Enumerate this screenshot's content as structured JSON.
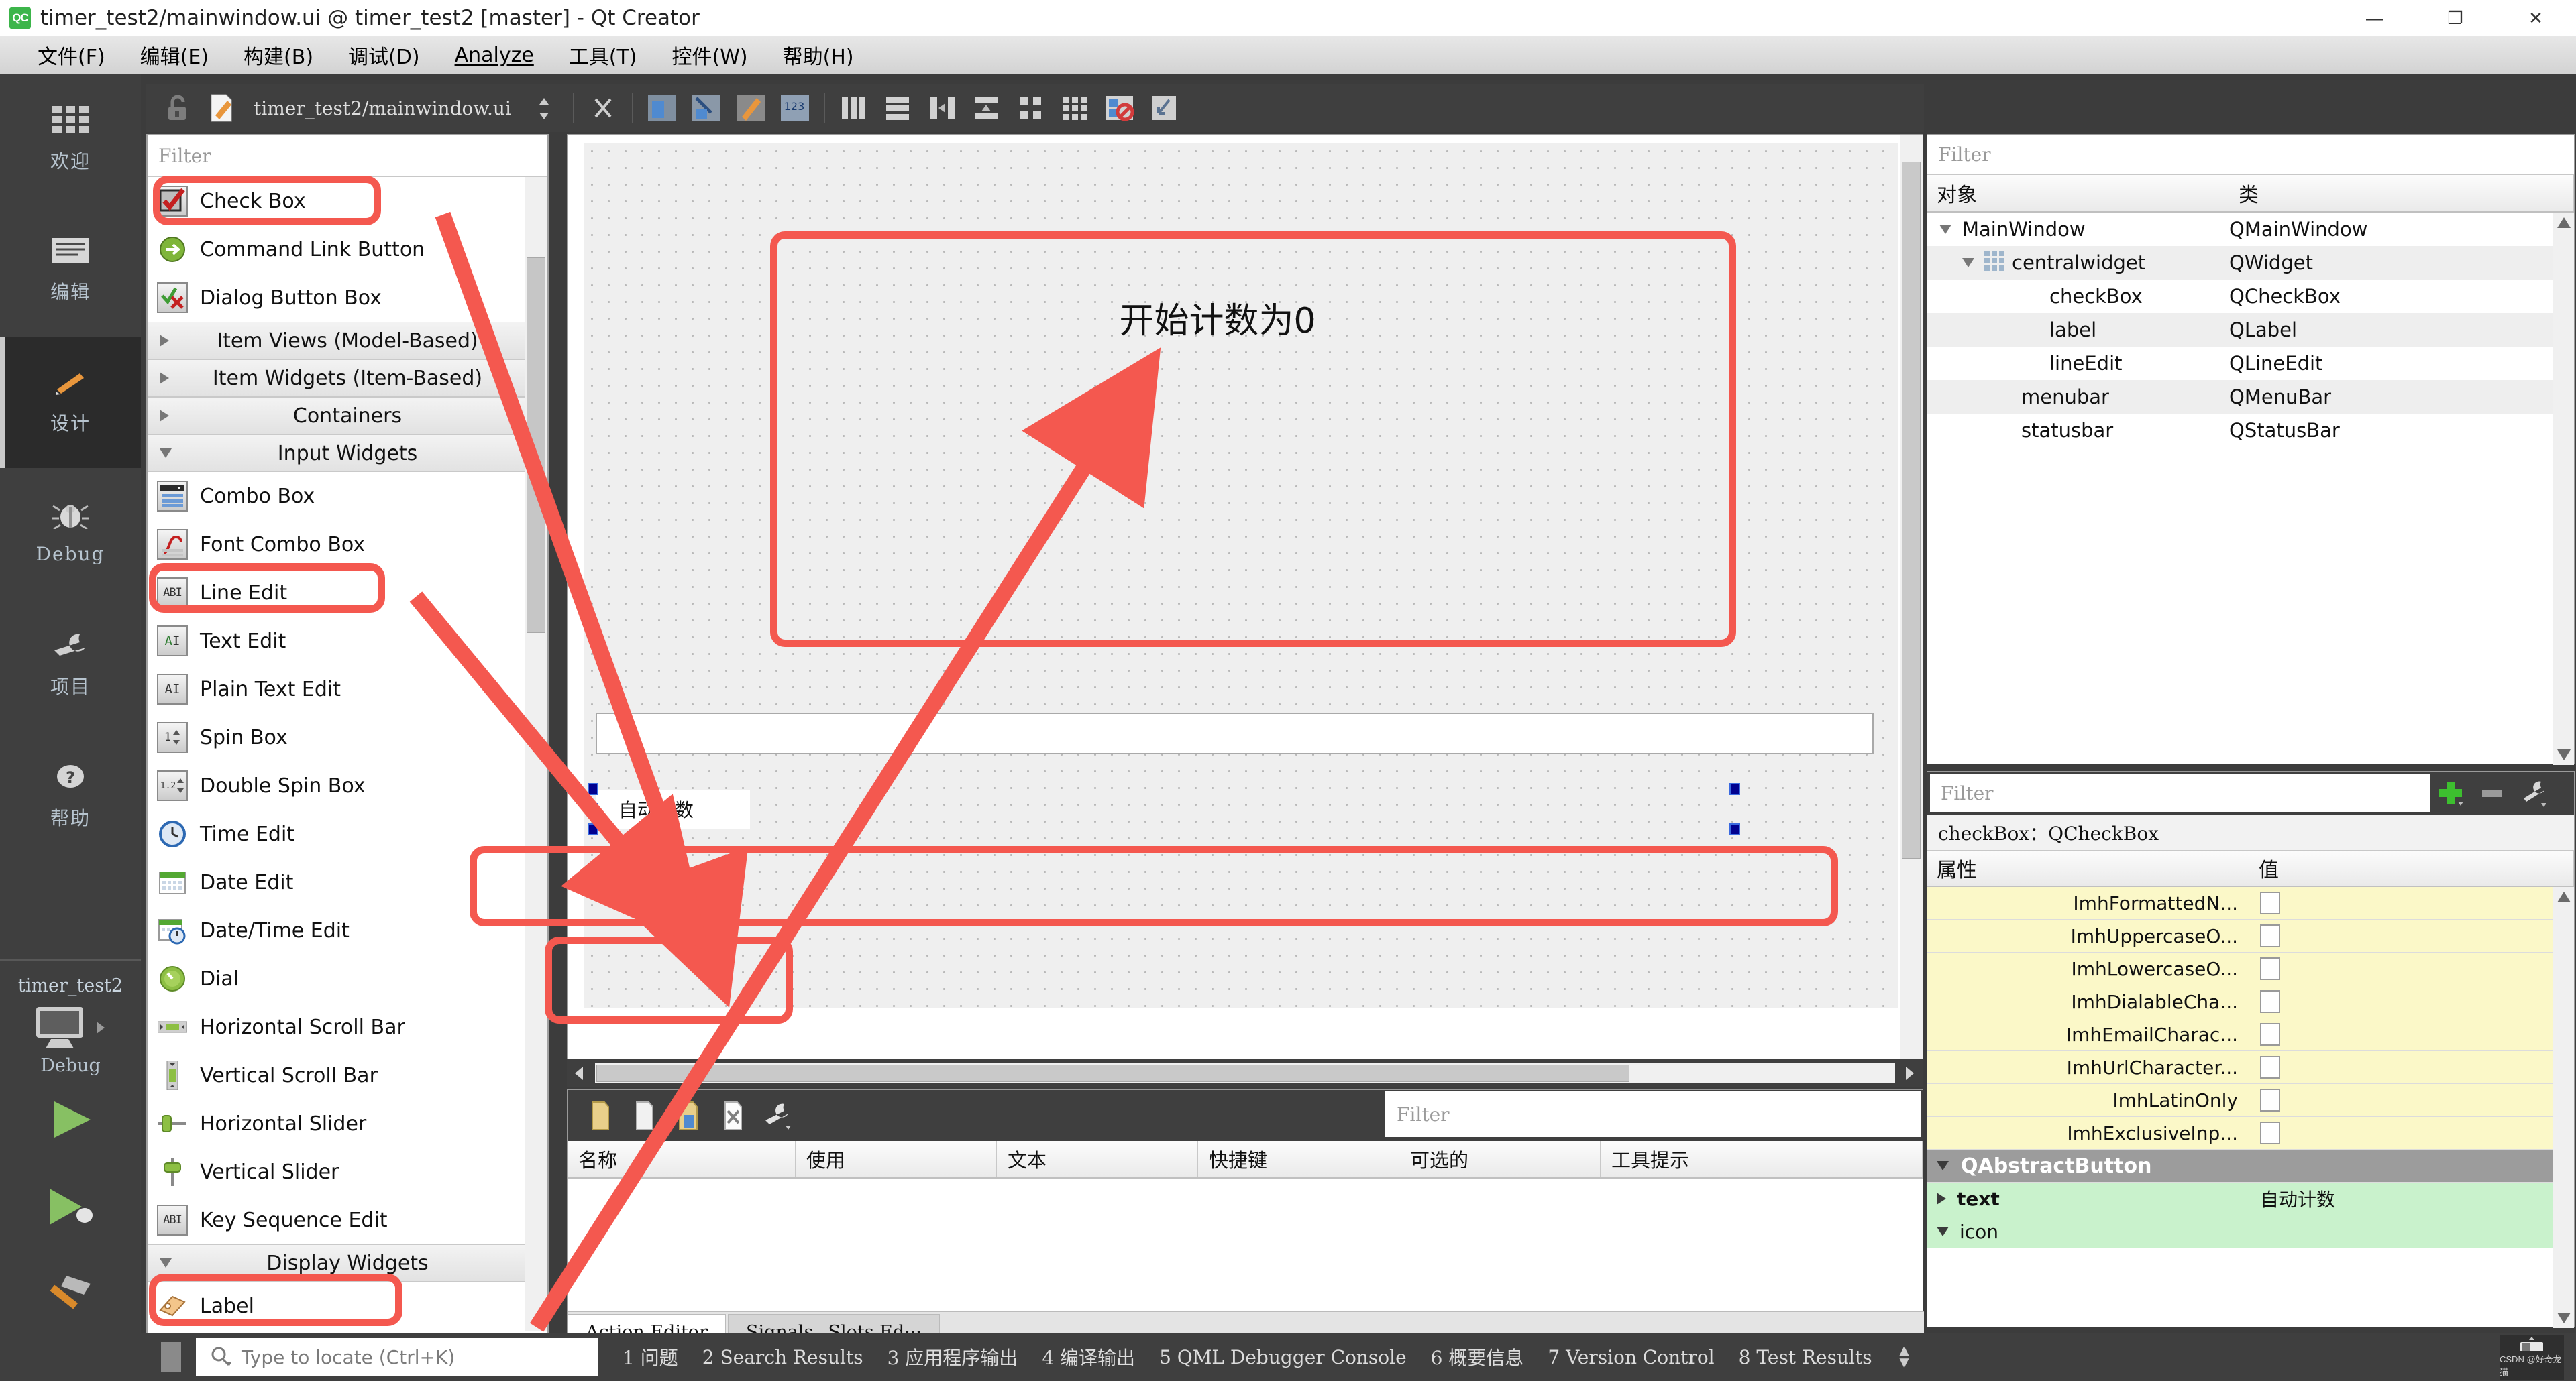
{
  "titlebar": {
    "logo": "QC",
    "title": "timer_test2/mainwindow.ui @ timer_test2 [master] - Qt Creator",
    "minimize": "—",
    "maximize": "❐",
    "close": "✕"
  },
  "menubar": {
    "items": [
      {
        "label": "文件(F)"
      },
      {
        "label": "编辑(E)"
      },
      {
        "label": "构建(B)"
      },
      {
        "label": "调试(D)"
      },
      {
        "label": "Analyze"
      },
      {
        "label": "工具(T)"
      },
      {
        "label": "控件(W)"
      },
      {
        "label": "帮助(H)"
      }
    ]
  },
  "modebar": {
    "items": [
      {
        "label": "欢迎",
        "icon": "grid-icon",
        "active": false
      },
      {
        "label": "编辑",
        "icon": "lines-icon",
        "active": false
      },
      {
        "label": "设计",
        "icon": "pencil-icon",
        "active": true
      },
      {
        "label": "Debug",
        "icon": "bug-icon",
        "active": false
      },
      {
        "label": "项目",
        "icon": "wrench-icon",
        "active": false
      },
      {
        "label": "帮助",
        "icon": "help-icon",
        "active": false
      }
    ]
  },
  "kit_selector": {
    "project": "timer_test2",
    "build": "Debug",
    "run_label": "run",
    "debug_label": "debug",
    "build_label": "build"
  },
  "widgetbox": {
    "filter_placeholder": "Filter",
    "items": [
      {
        "type": "widget",
        "label": "Check Box",
        "icon": "checkbox-icon",
        "highlighted": true
      },
      {
        "type": "widget",
        "label": "Command Link Button",
        "icon": "command-link-icon",
        "highlighted": false
      },
      {
        "type": "widget",
        "label": "Dialog Button Box",
        "icon": "dialog-buttonbox-icon",
        "highlighted": false
      },
      {
        "type": "category",
        "label": "Item Views (Model-Based)",
        "expanded": false
      },
      {
        "type": "category",
        "label": "Item Widgets (Item-Based)",
        "expanded": false
      },
      {
        "type": "category",
        "label": "Containers",
        "expanded": false
      },
      {
        "type": "category",
        "label": "Input Widgets",
        "expanded": true
      },
      {
        "type": "widget",
        "label": "Combo Box",
        "icon": "combobox-icon",
        "highlighted": false
      },
      {
        "type": "widget",
        "label": "Font Combo Box",
        "icon": "fontcombo-icon",
        "highlighted": false
      },
      {
        "type": "widget",
        "label": "Line Edit",
        "icon": "lineedit-icon",
        "highlighted": true
      },
      {
        "type": "widget",
        "label": "Text Edit",
        "icon": "textedit-icon",
        "highlighted": false
      },
      {
        "type": "widget",
        "label": "Plain Text Edit",
        "icon": "plaintextedit-icon",
        "highlighted": false
      },
      {
        "type": "widget",
        "label": "Spin Box",
        "icon": "spinbox-icon",
        "highlighted": false
      },
      {
        "type": "widget",
        "label": "Double Spin Box",
        "icon": "doublespinbox-icon",
        "highlighted": false
      },
      {
        "type": "widget",
        "label": "Time Edit",
        "icon": "clock-icon",
        "highlighted": false
      },
      {
        "type": "widget",
        "label": "Date Edit",
        "icon": "calendar-icon",
        "highlighted": false
      },
      {
        "type": "widget",
        "label": "Date/Time Edit",
        "icon": "calendar-clock-icon",
        "highlighted": false
      },
      {
        "type": "widget",
        "label": "Dial",
        "icon": "dial-icon",
        "highlighted": false
      },
      {
        "type": "widget",
        "label": "Horizontal Scroll Bar",
        "icon": "hscrollbar-icon",
        "highlighted": false
      },
      {
        "type": "widget",
        "label": "Vertical Scroll Bar",
        "icon": "vscrollbar-icon",
        "highlighted": false
      },
      {
        "type": "widget",
        "label": "Horizontal Slider",
        "icon": "hslider-icon",
        "highlighted": false
      },
      {
        "type": "widget",
        "label": "Vertical Slider",
        "icon": "vslider-icon",
        "highlighted": false
      },
      {
        "type": "widget",
        "label": "Key Sequence Edit",
        "icon": "keysequence-icon",
        "highlighted": false
      },
      {
        "type": "category",
        "label": "Display Widgets",
        "expanded": true
      },
      {
        "type": "widget",
        "label": "Label",
        "icon": "label-icon",
        "highlighted": true
      }
    ]
  },
  "form_toolbar": {
    "filename": "timer_test2/mainwindow.ui",
    "icons": [
      "unlock-icon",
      "edit-file-icon",
      "split-icon",
      "close-icon",
      "edit-widgets-icon",
      "edit-signals-icon",
      "edit-buddies-icon",
      "edit-taborder-icon",
      "layout-horizontal-icon",
      "layout-vertical-icon",
      "layout-splitter-h-icon",
      "layout-splitter-v-icon",
      "layout-form-icon",
      "layout-grid-icon",
      "break-layout-icon",
      "adjust-size-icon"
    ]
  },
  "canvas": {
    "label_text": "开始计数为0",
    "lineedit_text": "",
    "checkbox_text": "自动计数"
  },
  "action_editor": {
    "filter_placeholder": "Filter",
    "columns": [
      "名称",
      "使用",
      "文本",
      "快捷键",
      "可选的",
      "工具提示"
    ],
    "rows": [],
    "tabs": [
      {
        "label": "Action Editor",
        "selected": true
      },
      {
        "label": "Signals _Slots Ed···",
        "selected": false
      }
    ]
  },
  "object_inspector": {
    "filter_placeholder": "Filter",
    "columns": [
      "对象",
      "类"
    ],
    "rows": [
      {
        "object": "MainWindow",
        "class": "QMainWindow",
        "indent": 0,
        "expander": "down"
      },
      {
        "object": "centralwidget",
        "class": "QWidget",
        "indent": 1,
        "expander": "down",
        "icon": "widget-grid-icon"
      },
      {
        "object": "checkBox",
        "class": "QCheckBox",
        "indent": 2,
        "expander": ""
      },
      {
        "object": "label",
        "class": "QLabel",
        "indent": 2,
        "expander": ""
      },
      {
        "object": "lineEdit",
        "class": "QLineEdit",
        "indent": 2,
        "expander": ""
      },
      {
        "object": "menubar",
        "class": "QMenuBar",
        "indent": 1,
        "expander": ""
      },
      {
        "object": "statusbar",
        "class": "QStatusBar",
        "indent": 1,
        "expander": ""
      }
    ]
  },
  "property_editor": {
    "filter_placeholder": "Filter",
    "add_label": "+",
    "remove_label": "−",
    "configure_label": "⚙",
    "subject": "checkBox：QCheckBox",
    "columns": [
      "属性",
      "值"
    ],
    "rows": [
      {
        "name": "ImhFormattedN...",
        "value": "",
        "kind": "imh",
        "checkbox": true
      },
      {
        "name": "ImhUppercaseO...",
        "value": "",
        "kind": "imh",
        "checkbox": true
      },
      {
        "name": "ImhLowercaseO...",
        "value": "",
        "kind": "imh",
        "checkbox": true
      },
      {
        "name": "ImhDialableCha...",
        "value": "",
        "kind": "imh",
        "checkbox": true
      },
      {
        "name": "ImhEmailCharac...",
        "value": "",
        "kind": "imh",
        "checkbox": true
      },
      {
        "name": "ImhUrlCharacter...",
        "value": "",
        "kind": "imh",
        "checkbox": true
      },
      {
        "name": "ImhLatinOnly",
        "value": "",
        "kind": "imh",
        "checkbox": true
      },
      {
        "name": "ImhExclusiveInp...",
        "value": "",
        "kind": "imh",
        "checkbox": true
      },
      {
        "name": "QAbstractButton",
        "value": "",
        "kind": "group",
        "checkbox": false
      },
      {
        "name": "text",
        "value": "自动计数",
        "kind": "button",
        "checkbox": false,
        "expander": "right"
      },
      {
        "name": "icon",
        "value": "",
        "kind": "button",
        "checkbox": false,
        "expander": "down"
      }
    ]
  },
  "bottombar": {
    "locator_placeholder": "Type to locate (Ctrl+K)",
    "search_icon": "search-icon",
    "output_tabs": [
      {
        "num": "1",
        "label": "问题"
      },
      {
        "num": "2",
        "label": "Search Results"
      },
      {
        "num": "3",
        "label": "应用程序输出"
      },
      {
        "num": "4",
        "label": "编译输出"
      },
      {
        "num": "5",
        "label": "QML Debugger Console"
      },
      {
        "num": "6",
        "label": "概要信息"
      },
      {
        "num": "7",
        "label": "Version Control"
      },
      {
        "num": "8",
        "label": "Test Results"
      }
    ],
    "watermark": "CSDN @好奇龙猫"
  },
  "annotation": {
    "color": "#f4584f",
    "boxes": [
      {
        "name": "checkbox-widget-highlight"
      },
      {
        "name": "lineedit-widget-highlight"
      },
      {
        "name": "label-widget-highlight"
      },
      {
        "name": "canvas-label-highlight"
      },
      {
        "name": "canvas-lineedit-highlight"
      },
      {
        "name": "canvas-checkbox-highlight"
      }
    ]
  }
}
